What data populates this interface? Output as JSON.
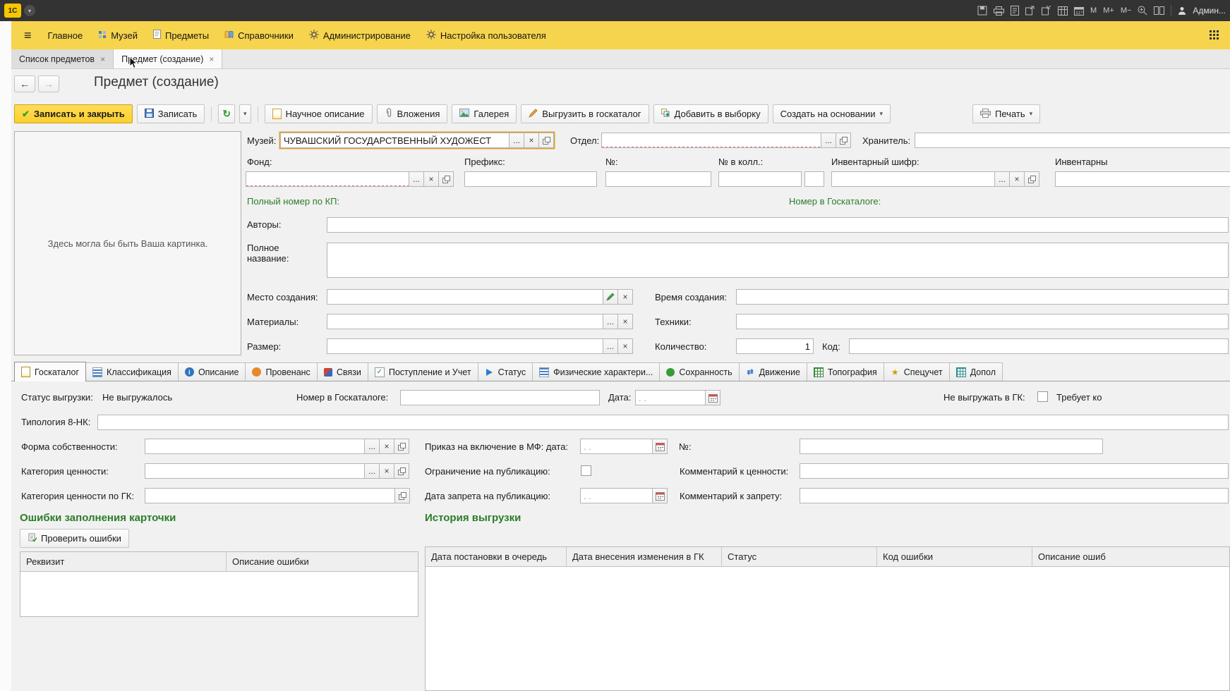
{
  "titlebar": {
    "logo": "1С",
    "user": "Админ...",
    "memory": [
      "M",
      "M+",
      "M−"
    ]
  },
  "menubar": {
    "items": [
      "Главное",
      "Музей",
      "Предметы",
      "Справочники",
      "Администрирование",
      "Настройка пользователя"
    ]
  },
  "window_tabs": [
    {
      "label": "Список предметов",
      "close": "×"
    },
    {
      "label": "Предмет (создание)",
      "close": "×"
    }
  ],
  "page": {
    "title": "Предмет (создание)"
  },
  "glyphs": {
    "ellipsis": "...",
    "clear": "×",
    "dropdown": "▾",
    "back": "←",
    "forward": "→",
    "hamburger": "≡",
    "refresh": "↻",
    "check": "✔"
  },
  "commands": {
    "save_close": "Записать и закрыть",
    "save": "Записать",
    "scientific": "Научное описание",
    "attachments": "Вложения",
    "gallery": "Галерея",
    "upload": "Выгрузить в госкаталог",
    "add_to_selection": "Добавить в выборку",
    "create_based_on": "Создать на основании",
    "print": "Печать"
  },
  "form": {
    "image_placeholder": "Здесь могла бы быть Ваша картинка.",
    "labels": {
      "museum": "Музей:",
      "department": "Отдел:",
      "keeper": "Хранитель:",
      "fund": "Фонд:",
      "prefix": "Префикс:",
      "number": "№:",
      "number_in_coll": "№ в колл.:",
      "inventory_code": "Инвентарный шифр:",
      "inventory_cut": "Инвентарны",
      "full_kp_number": "Полный номер по КП:",
      "goskatalog_number": "Номер в Госкаталоге:",
      "authors": "Авторы:",
      "full_title": "Полное название:",
      "place_created": "Место создания:",
      "time_created": "Время создания:",
      "materials": "Материалы:",
      "techniques": "Техники:",
      "size": "Размер:",
      "quantity": "Количество:",
      "code": "Код:"
    },
    "values": {
      "museum": "ЧУВАШСКИЙ ГОСУДАРСТВЕННЫЙ ХУДОЖЕСТ",
      "quantity": "1"
    }
  },
  "section_tabs": [
    {
      "label": "Госкаталог",
      "icon": "doc-yellow-icon",
      "active": true
    },
    {
      "label": "Классификация",
      "icon": "list-blue-icon"
    },
    {
      "label": "Описание",
      "icon": "info-icon"
    },
    {
      "label": "Провенанс",
      "icon": "clock-icon"
    },
    {
      "label": "Связи",
      "icon": "links-icon"
    },
    {
      "label": "Поступление и Учет",
      "icon": "checkbox-icon"
    },
    {
      "label": "Статус",
      "icon": "arrow-icon"
    },
    {
      "label": "Физические характери...",
      "icon": "bars-icon"
    },
    {
      "label": "Сохранность",
      "icon": "green-dot-icon"
    },
    {
      "label": "Движение",
      "icon": "move-icon"
    },
    {
      "label": "Топография",
      "icon": "grid-green-icon"
    },
    {
      "label": "Спецучет",
      "icon": "star-icon"
    },
    {
      "label": "Допол",
      "icon": "grid-teal-icon"
    }
  ],
  "goskatalog": {
    "upload_status_label": "Статус выгрузки:",
    "upload_status_value": "Не выгружалось",
    "gk_number_label": "Номер в Госкаталоге:",
    "date_label": "Дата:",
    "date_placeholder": ". .",
    "no_upload_label": "Не выгружать в ГК:",
    "requires_cut": "Требует ко",
    "typology_label": "Типология 8-НК:",
    "ownership_label": "Форма собственности:",
    "mf_order_label": "Приказ на включение в МФ: дата:",
    "mf_number_label": "№:",
    "value_category_label": "Категория ценности:",
    "publication_limit_label": "Ограничение на публикацию:",
    "value_comment_label": "Комментарий к ценности:",
    "value_category_gk_label": "Категория ценности по ГК:",
    "publication_ban_date_label": "Дата запрета на публикацию:",
    "ban_comment_label": "Комментарий к запрету:",
    "errors_heading": "Ошибки заполнения карточки",
    "check_errors": "Проверить ошибки",
    "errors_table_headers": [
      "Реквизит",
      "Описание ошибки"
    ],
    "history_heading": "История выгрузки",
    "history_table_headers": [
      "Дата постановки в очередь",
      "Дата внесения изменения в ГК",
      "Статус",
      "Код ошибки",
      "Описание ошиб"
    ]
  }
}
